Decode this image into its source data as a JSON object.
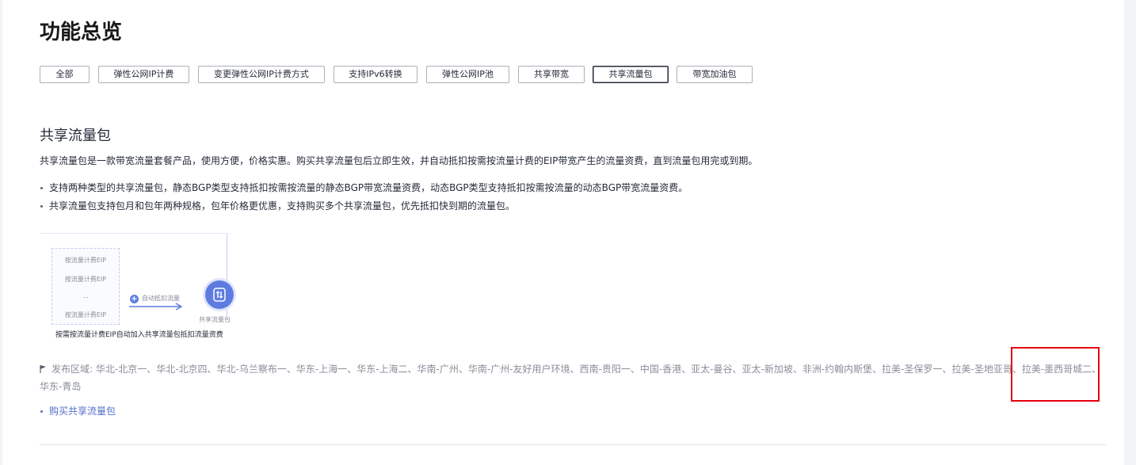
{
  "page_title": "功能总览",
  "tabs": [
    "全部",
    "弹性公网IP计费",
    "变更弹性公网IP计费方式",
    "支持IPv6转换",
    "弹性公网IP池",
    "共享带宽",
    "共享流量包",
    "带宽加油包"
  ],
  "active_tab": "共享流量包",
  "section": {
    "title": "共享流量包",
    "description": "共享流量包是一款带宽流量套餐产品，使用方便，价格实惠。购买共享流量包后立即生效，并自动抵扣按需按流量计费的EIP带宽产生的流量资费，直到流量包用完或到期。",
    "bullets": [
      "支持两种类型的共享流量包，静态BGP类型支持抵扣按需按流量的静态BGP带宽流量资费，动态BGP类型支持抵扣按需按流量的动态BGP带宽流量资费。",
      "共享流量包支持包月和包年两种规格，包年价格更优惠，支持购买多个共享流量包，优先抵扣快到期的流量包。"
    ]
  },
  "diagram": {
    "eip_items": [
      "按流量计费EIP",
      "按流量计费EIP",
      "...",
      "按流量计费EIP"
    ],
    "arrow_label": "自动抵扣流量",
    "package_label": "共享流量包",
    "caption": "按需按流量计费EIP自动加入共享流量包抵扣流量资费",
    "package_icon": "traffic-package-icon"
  },
  "regions": {
    "label": "发布区域:",
    "text": "华北-北京一、华北-北京四、华北-乌兰察布一、华东-上海一、华东-上海二、华南-广州、华南-广州-友好用户环境、西南-贵阳一、中国-香港、亚太-曼谷、亚太-新加坡、非洲-约翰内斯堡、拉美-圣保罗一、拉美-圣地亚哥、拉美-墨西哥城二、华东-青岛"
  },
  "buy_link": "购买共享流量包",
  "colors": {
    "accent": "#5e7ce0",
    "link": "#526ecc",
    "highlight": "#e6000f",
    "muted_text": "#8a8e99"
  }
}
